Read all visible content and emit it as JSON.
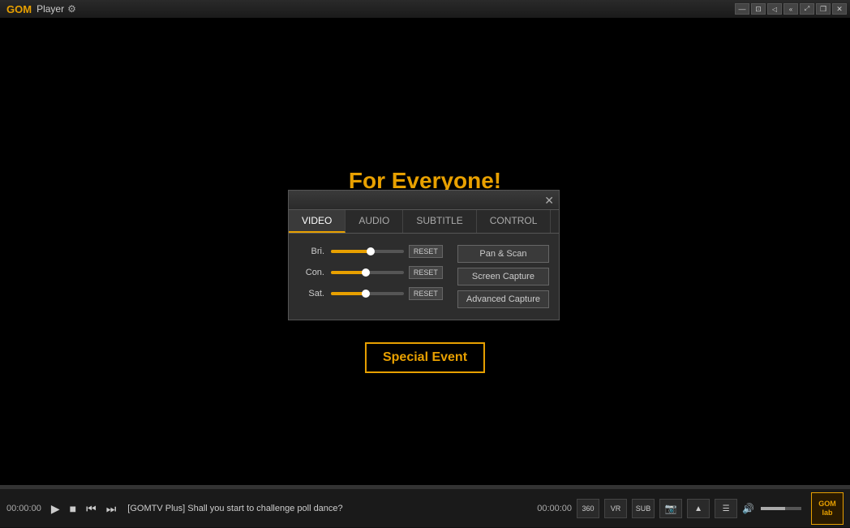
{
  "titlebar": {
    "logo": "GOM",
    "title": "Player",
    "gear_icon": "⚙"
  },
  "titlebar_controls": {
    "minimize": "—",
    "snap": "⊡",
    "speaker": "◁",
    "rewind": "«",
    "expand": "⤢",
    "restore": "❐",
    "close": "✕"
  },
  "promo": {
    "text": "For Everyone!"
  },
  "special_event": {
    "label": "Special Event"
  },
  "dialog": {
    "close_icon": "✕",
    "tabs": [
      {
        "label": "VIDEO",
        "active": true
      },
      {
        "label": "AUDIO",
        "active": false
      },
      {
        "label": "SUBTITLE",
        "active": false
      },
      {
        "label": "CONTROL",
        "active": false
      }
    ],
    "sliders": [
      {
        "label": "Bri.",
        "value": 55,
        "reset": "RESET"
      },
      {
        "label": "Con.",
        "value": 48,
        "reset": "RESET"
      },
      {
        "label": "Sat.",
        "value": 48,
        "reset": "RESET"
      }
    ],
    "buttons": [
      {
        "label": "Pan & Scan"
      },
      {
        "label": "Screen Capture"
      },
      {
        "label": "Advanced Capture"
      }
    ]
  },
  "control_bar": {
    "time_left": "00:00:00",
    "time_right": "00:00:00",
    "song_title": "[GOMTV Plus] Shall you start to challenge poll dance?",
    "play_icon": "▶",
    "stop_icon": "■",
    "prev_icon": "⏮",
    "next_icon": "⏭",
    "volume_icon": "🔊",
    "icon_360": "360",
    "icon_vr": "VR",
    "icon_sub": "SUB",
    "icon_cam": "📷",
    "icon_up": "▲",
    "icon_menu": "☰",
    "gom_logo": "GOMlab"
  }
}
